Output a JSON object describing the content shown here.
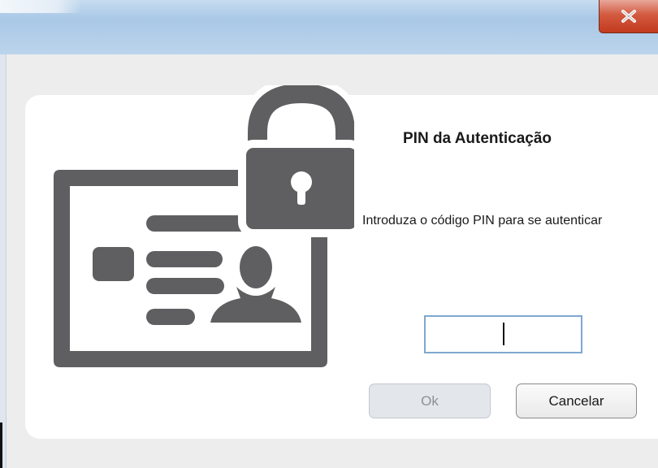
{
  "window": {
    "close_label": "X"
  },
  "dialog": {
    "title": "PIN da Autenticação",
    "prompt": "Introduza o código PIN para se autenticar",
    "pin_value": "",
    "ok_label": "Ok",
    "cancel_label": "Cancelar"
  },
  "icons": {
    "illustration": "id-card-lock-icon",
    "close": "close-icon"
  },
  "colors": {
    "illustration": "#5f5f61",
    "titlebar": "#b7d1ea",
    "close_button": "#c94a2e",
    "input_border": "#7fa8cf"
  }
}
